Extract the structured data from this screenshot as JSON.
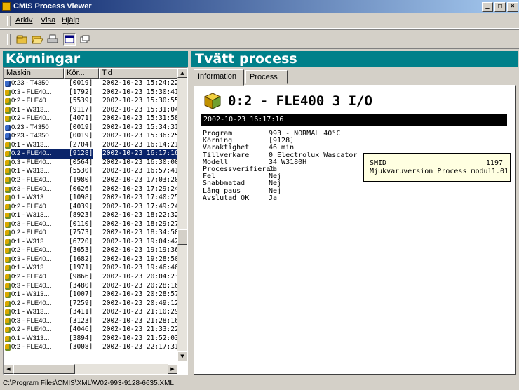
{
  "window": {
    "title": "CMIS Process Viewer",
    "buttons": [
      "_",
      "□",
      "×"
    ]
  },
  "menu": [
    "Arkiv",
    "Visa",
    "Hjälp"
  ],
  "toolbar": {
    "icons": [
      "new-icon",
      "open-icon",
      "print-icon",
      "view-icon",
      "window-icon"
    ]
  },
  "left": {
    "title": "Körningar",
    "columns": [
      "Maskin",
      "Kör...",
      "Tid"
    ],
    "rows": [
      {
        "maskin": "0:23 - T4350",
        "kor": "[0019]",
        "tid": "2002-10-23 15:24:22",
        "icon": "blue"
      },
      {
        "maskin": "0:3 - FLE40...",
        "kor": "[1792]",
        "tid": "2002-10-23 15:30:41",
        "icon": "yellow"
      },
      {
        "maskin": "0:2 - FLE40...",
        "kor": "[5539]",
        "tid": "2002-10-23 15:30:55",
        "icon": "yellow"
      },
      {
        "maskin": "0:1 - W313...",
        "kor": "[9117]",
        "tid": "2002-10-23 15:31:04",
        "icon": "yellow"
      },
      {
        "maskin": "0:2 - FLE40...",
        "kor": "[4071]",
        "tid": "2002-10-23 15:31:58",
        "icon": "yellow"
      },
      {
        "maskin": "0:23 - T4350",
        "kor": "[0019]",
        "tid": "2002-10-23 15:34:31",
        "icon": "blue"
      },
      {
        "maskin": "0:23 - T4350",
        "kor": "[0019]",
        "tid": "2002-10-23 15:36:25",
        "icon": "blue"
      },
      {
        "maskin": "0:1 - W313...",
        "kor": "[2704]",
        "tid": "2002-10-23 16:14:21",
        "icon": "yellow"
      },
      {
        "maskin": "0:2 - FLE40...",
        "kor": "[9128]",
        "tid": "2002-10-23 16:17:16",
        "icon": "yellow",
        "selected": true
      },
      {
        "maskin": "0:3 - FLE40...",
        "kor": "[0564]",
        "tid": "2002-10-23 16:30:00",
        "icon": "yellow"
      },
      {
        "maskin": "0:1 - W313...",
        "kor": "[5530]",
        "tid": "2002-10-23 16:57:41",
        "icon": "yellow"
      },
      {
        "maskin": "0:2 - FLE40...",
        "kor": "[1980]",
        "tid": "2002-10-23 17:03:20",
        "icon": "yellow"
      },
      {
        "maskin": "0:3 - FLE40...",
        "kor": "[0626]",
        "tid": "2002-10-23 17:29:24",
        "icon": "yellow"
      },
      {
        "maskin": "0:1 - W313...",
        "kor": "[1098]",
        "tid": "2002-10-23 17:40:25",
        "icon": "yellow"
      },
      {
        "maskin": "0:2 - FLE40...",
        "kor": "[4039]",
        "tid": "2002-10-23 17:49:24",
        "icon": "yellow"
      },
      {
        "maskin": "0:1 - W313...",
        "kor": "[8923]",
        "tid": "2002-10-23 18:22:32",
        "icon": "yellow"
      },
      {
        "maskin": "0:3 - FLE40...",
        "kor": "[0110]",
        "tid": "2002-10-23 18:29:27",
        "icon": "yellow"
      },
      {
        "maskin": "0:2 - FLE40...",
        "kor": "[7573]",
        "tid": "2002-10-23 18:34:50",
        "icon": "yellow"
      },
      {
        "maskin": "0:1 - W313...",
        "kor": "[6720]",
        "tid": "2002-10-23 19:04:42",
        "icon": "yellow"
      },
      {
        "maskin": "0:2 - FLE40...",
        "kor": "[3653]",
        "tid": "2002-10-23 19:19:36",
        "icon": "yellow"
      },
      {
        "maskin": "0:3 - FLE40...",
        "kor": "[1682]",
        "tid": "2002-10-23 19:28:50",
        "icon": "yellow"
      },
      {
        "maskin": "0:1 - W313...",
        "kor": "[1971]",
        "tid": "2002-10-23 19:46:46",
        "icon": "yellow"
      },
      {
        "maskin": "0:2 - FLE40...",
        "kor": "[9866]",
        "tid": "2002-10-23 20:04:23",
        "icon": "yellow"
      },
      {
        "maskin": "0:3 - FLE40...",
        "kor": "[3480]",
        "tid": "2002-10-23 20:28:16",
        "icon": "yellow"
      },
      {
        "maskin": "0:1 - W313...",
        "kor": "[1007]",
        "tid": "2002-10-23 20:28:57",
        "icon": "yellow"
      },
      {
        "maskin": "0:2 - FLE40...",
        "kor": "[7259]",
        "tid": "2002-10-23 20:49:12",
        "icon": "yellow"
      },
      {
        "maskin": "0:1 - W313...",
        "kor": "[3411]",
        "tid": "2002-10-23 21:10:29",
        "icon": "yellow"
      },
      {
        "maskin": "0:3 - FLE40...",
        "kor": "[3123]",
        "tid": "2002-10-23 21:28:16",
        "icon": "yellow"
      },
      {
        "maskin": "0:2 - FLE40...",
        "kor": "[4046]",
        "tid": "2002-10-23 21:33:22",
        "icon": "yellow"
      },
      {
        "maskin": "0:1 - W313...",
        "kor": "[3894]",
        "tid": "2002-10-23 21:52:03",
        "icon": "yellow"
      },
      {
        "maskin": "0:2 - FLE40...",
        "kor": "[3008]",
        "tid": "2002-10-23 22:17:31",
        "icon": "yellow"
      }
    ]
  },
  "right": {
    "title": "Tvätt process",
    "tabs": [
      "Information",
      "Process"
    ],
    "heading": "0:2 - FLE400 3 I/O",
    "datetime": "2002-10-23 16:17:16",
    "properties": [
      {
        "k": "Program",
        "v": "993 - NORMAL 40°C"
      },
      {
        "k": "Körning",
        "v": "[9128]"
      },
      {
        "k": "Varaktighet",
        "v": "46 min"
      },
      {
        "k": "Tillverkare",
        "v": "0 Electrolux Wascator"
      },
      {
        "k": "Modell",
        "v": "34 W3180H"
      },
      {
        "k": "Processverifierad",
        "v": "Ja"
      },
      {
        "k": "Fel",
        "v": "Nej"
      },
      {
        "k": "Snabbmatad",
        "v": "Nej"
      },
      {
        "k": "Lång paus",
        "v": "Nej"
      },
      {
        "k": "Avslutad OK",
        "v": "Ja"
      }
    ],
    "info": [
      {
        "k": "SMID",
        "v": "1197"
      },
      {
        "k": "Mjukvaruversion Process modul",
        "v": "1.01"
      }
    ]
  },
  "status": "C:\\Program Files\\CMIS\\XML\\W02-993-9128-6635.XML",
  "colors": {
    "header_bg": "#00808a",
    "selection": "#0a246a"
  }
}
